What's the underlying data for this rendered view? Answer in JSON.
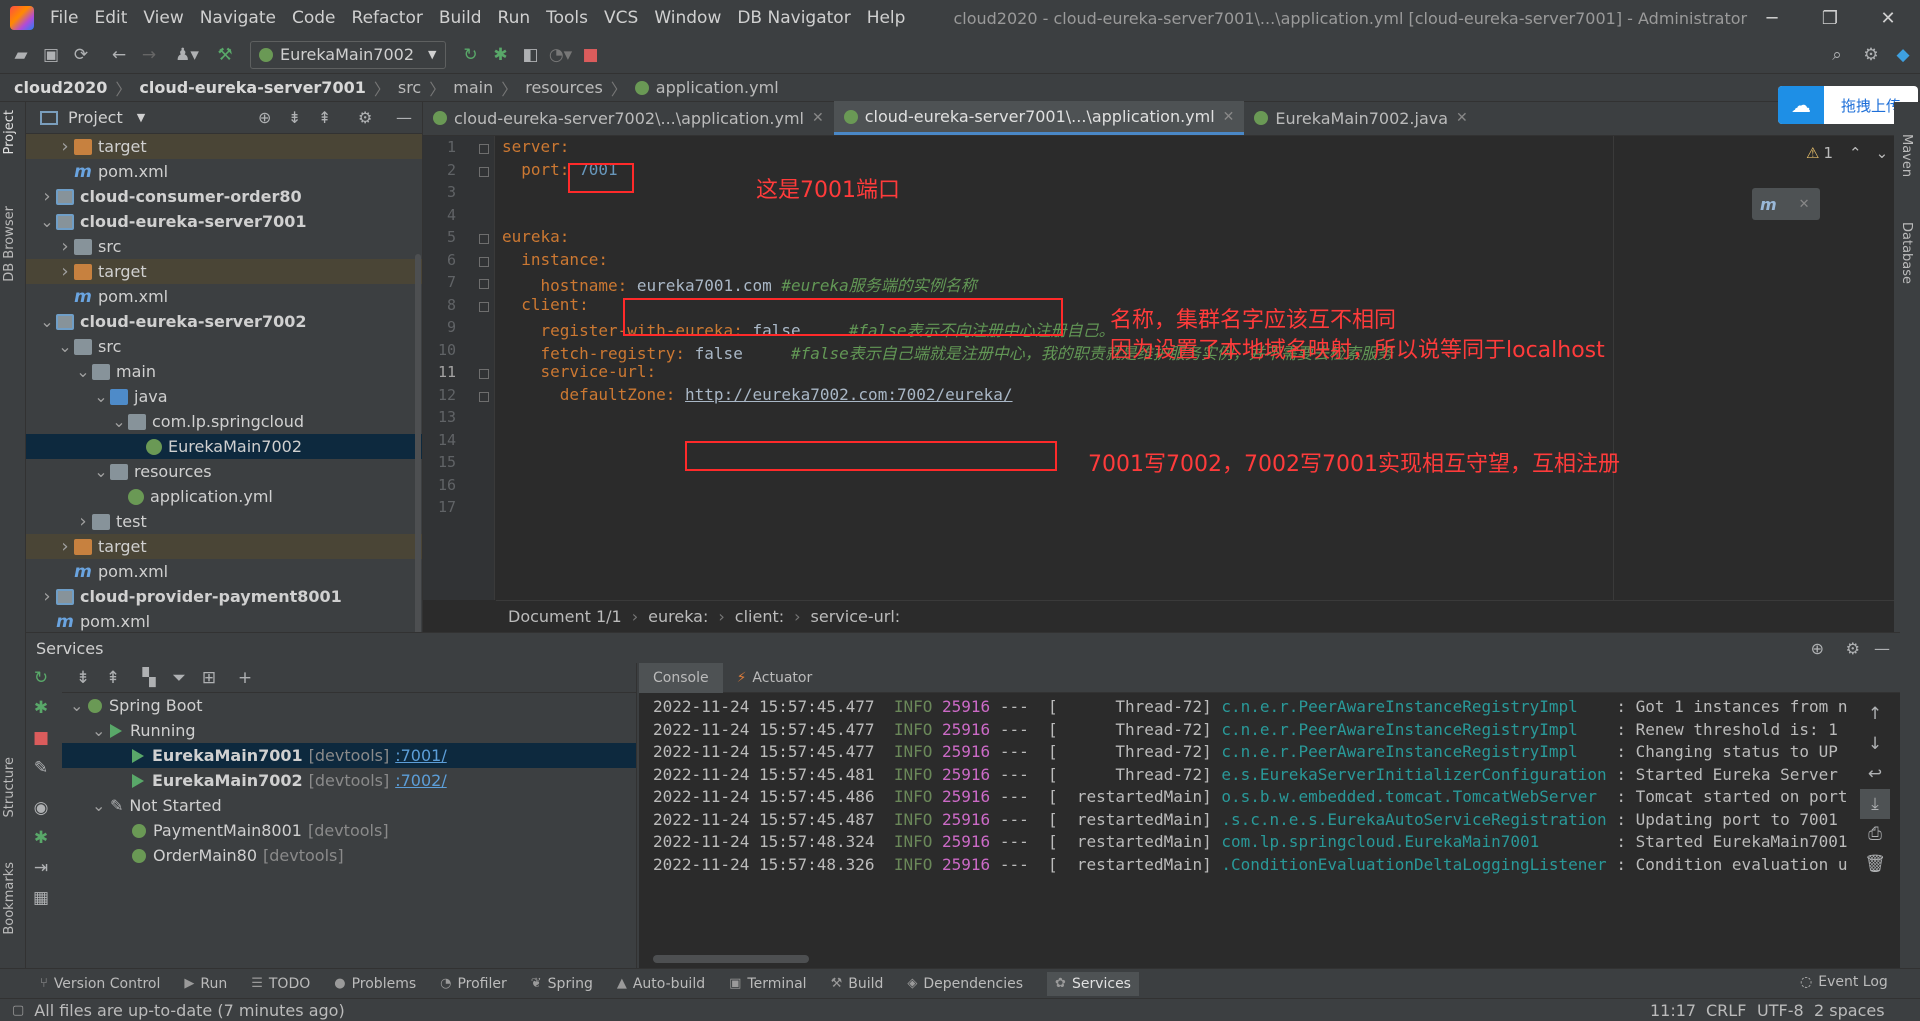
{
  "menubar": {
    "items": [
      "File",
      "Edit",
      "View",
      "Navigate",
      "Code",
      "Refactor",
      "Build",
      "Run",
      "Tools",
      "VCS",
      "Window",
      "DB Navigator",
      "Help"
    ],
    "title": "cloud2020 - cloud-eureka-server7001\\...\\application.yml [cloud-eureka-server7001] - Administrator"
  },
  "toolbar": {
    "run_config": "EurekaMain7002"
  },
  "breadcrumb": {
    "items": [
      "cloud2020",
      "cloud-eureka-server7001",
      "src",
      "main",
      "resources",
      "application.yml"
    ]
  },
  "project": {
    "title": "Project",
    "nodes": [
      {
        "label": "target",
        "type": "folder-orange",
        "depth": 2,
        "arrow": ">",
        "style": "tgt"
      },
      {
        "label": "pom.xml",
        "type": "maven",
        "depth": 2,
        "arrow": "",
        "style": ""
      },
      {
        "label": "cloud-consumer-order80",
        "type": "module",
        "depth": 1,
        "arrow": ">",
        "style": "",
        "bold": true
      },
      {
        "label": "cloud-eureka-server7001",
        "type": "module",
        "depth": 1,
        "arrow": "v",
        "style": "",
        "bold": true
      },
      {
        "label": "src",
        "type": "folder",
        "depth": 2,
        "arrow": ">",
        "style": ""
      },
      {
        "label": "target",
        "type": "folder-orange",
        "depth": 2,
        "arrow": ">",
        "style": "tgt"
      },
      {
        "label": "pom.xml",
        "type": "maven",
        "depth": 2,
        "arrow": "",
        "style": ""
      },
      {
        "label": "cloud-eureka-server7002",
        "type": "module",
        "depth": 1,
        "arrow": "v",
        "style": "",
        "bold": true
      },
      {
        "label": "src",
        "type": "folder",
        "depth": 2,
        "arrow": "v",
        "style": ""
      },
      {
        "label": "main",
        "type": "folder",
        "depth": 3,
        "arrow": "v",
        "style": ""
      },
      {
        "label": "java",
        "type": "folder-blue",
        "depth": 4,
        "arrow": "v",
        "style": ""
      },
      {
        "label": "com.lp.springcloud",
        "type": "package",
        "depth": 5,
        "arrow": "v",
        "style": ""
      },
      {
        "label": "EurekaMain7002",
        "type": "spring",
        "depth": 6,
        "arrow": "",
        "style": "sel"
      },
      {
        "label": "resources",
        "type": "folder",
        "depth": 4,
        "arrow": "v",
        "style": ""
      },
      {
        "label": "application.yml",
        "type": "spring",
        "depth": 5,
        "arrow": "",
        "style": ""
      },
      {
        "label": "test",
        "type": "folder",
        "depth": 3,
        "arrow": ">",
        "style": ""
      },
      {
        "label": "target",
        "type": "folder-orange",
        "depth": 2,
        "arrow": ">",
        "style": "tgt"
      },
      {
        "label": "pom.xml",
        "type": "maven",
        "depth": 2,
        "arrow": "",
        "style": ""
      },
      {
        "label": "cloud-provider-payment8001",
        "type": "module",
        "depth": 1,
        "arrow": ">",
        "style": "",
        "bold": true
      },
      {
        "label": "pom.xml",
        "type": "maven",
        "depth": 1,
        "arrow": "",
        "style": ""
      }
    ]
  },
  "tabs": [
    {
      "label": "cloud-eureka-server7002\\...\\application.yml",
      "active": false
    },
    {
      "label": "cloud-eureka-server7001\\...\\application.yml",
      "active": true
    },
    {
      "label": "EurekaMain7002.java",
      "active": false
    }
  ],
  "editor": {
    "line_numbers": [
      "1",
      "2",
      "3",
      "4",
      "5",
      "6",
      "7",
      "8",
      "9",
      "10",
      "11",
      "12",
      "13",
      "14",
      "15",
      "16",
      "17"
    ],
    "lines": [
      {
        "key": "server:",
        "val": "",
        "comment": ""
      },
      {
        "key": "  port: ",
        "val": "7001",
        "comment": "",
        "num": true
      },
      {
        "key": "",
        "val": "",
        "comment": ""
      },
      {
        "key": "",
        "val": "",
        "comment": ""
      },
      {
        "key": "eureka:",
        "val": "",
        "comment": ""
      },
      {
        "key": "  instance:",
        "val": "",
        "comment": ""
      },
      {
        "key": "    hostname: ",
        "val": "eureka7001.com ",
        "comment": "#eureka服务端的实例名称"
      },
      {
        "key": "  client:",
        "val": "",
        "comment": ""
      },
      {
        "key": "    register-with-eureka: ",
        "val": "false     ",
        "comment": "#false表示不向注册中心注册自己。"
      },
      {
        "key": "    fetch-registry: ",
        "val": "false     ",
        "comment": "#false表示自己端就是注册中心，我的职责就是维护服务实例，并不需要去检索服务"
      },
      {
        "key": "    service-url:",
        "val": "",
        "comment": ""
      },
      {
        "key": "      defaultZone: ",
        "val": "http://eureka7002.com:7002/eureka/",
        "comment": "",
        "url": true
      },
      {
        "key": "",
        "val": "",
        "comment": ""
      },
      {
        "key": "",
        "val": "",
        "comment": ""
      },
      {
        "key": "",
        "val": "",
        "comment": ""
      },
      {
        "key": "",
        "val": "",
        "comment": ""
      },
      {
        "key": "",
        "val": "",
        "comment": ""
      }
    ],
    "warnings": "1",
    "breadcrumb": [
      "Document 1/1",
      "eureka:",
      "client:",
      "service-url:"
    ]
  },
  "annotations": {
    "port_note": "这是7001端口",
    "name_note_1": "名称，集群名字应该互不相同",
    "name_note_2": "因为设置了本地域名映射，所以说等同于localhost",
    "url_note": "7001写7002，7002写7001实现相互守望，互相注册"
  },
  "upload_widget": {
    "label": "拖拽上传"
  },
  "services": {
    "title": "Services",
    "tree": [
      {
        "label": "Spring Boot",
        "depth": 0,
        "arrow": "v",
        "icon": "spring",
        "style": ""
      },
      {
        "label": "Running",
        "depth": 1,
        "arrow": "v",
        "icon": "run",
        "style": ""
      },
      {
        "label": "EurekaMain7001",
        "depth": 2,
        "arrow": "",
        "icon": "run",
        "style": "sel",
        "dim": "[devtools]",
        "link": ":7001/"
      },
      {
        "label": "EurekaMain7002",
        "depth": 2,
        "arrow": "",
        "icon": "run",
        "style": "",
        "dim": "[devtools]",
        "link": ":7002/"
      },
      {
        "label": "Not Started",
        "depth": 1,
        "arrow": "v",
        "icon": "wrench",
        "style": ""
      },
      {
        "label": "PaymentMain8001",
        "depth": 2,
        "arrow": "",
        "icon": "spring",
        "style": "",
        "dim": "[devtools]"
      },
      {
        "label": "OrderMain80",
        "depth": 2,
        "arrow": "",
        "icon": "spring",
        "style": "",
        "dim": "[devtools]"
      }
    ],
    "console_tabs": [
      "Console",
      "Actuator"
    ],
    "log": [
      {
        "ts": "2022-11-24 15:57:45.477",
        "lvl": "INFO",
        "pid": "25916",
        "thread": "---  [      Thread-72]",
        "cls": "c.n.e.r.PeerAwareInstanceRegistryImpl   ",
        "msg": ": Got 1 instances from n"
      },
      {
        "ts": "2022-11-24 15:57:45.477",
        "lvl": "INFO",
        "pid": "25916",
        "thread": "---  [      Thread-72]",
        "cls": "c.n.e.r.PeerAwareInstanceRegistryImpl   ",
        "msg": ": Renew threshold is: 1"
      },
      {
        "ts": "2022-11-24 15:57:45.477",
        "lvl": "INFO",
        "pid": "25916",
        "thread": "---  [      Thread-72]",
        "cls": "c.n.e.r.PeerAwareInstanceRegistryImpl   ",
        "msg": ": Changing status to UP"
      },
      {
        "ts": "2022-11-24 15:57:45.481",
        "lvl": "INFO",
        "pid": "25916",
        "thread": "---  [      Thread-72]",
        "cls": "e.s.EurekaServerInitializerConfiguration",
        "msg": ": Started Eureka Server"
      },
      {
        "ts": "2022-11-24 15:57:45.486",
        "lvl": "INFO",
        "pid": "25916",
        "thread": "---  [  restartedMain]",
        "cls": "o.s.b.w.embedded.tomcat.TomcatWebServer ",
        "msg": ": Tomcat started on port"
      },
      {
        "ts": "2022-11-24 15:57:45.487",
        "lvl": "INFO",
        "pid": "25916",
        "thread": "---  [  restartedMain]",
        "cls": ".s.c.n.e.s.EurekaAutoServiceRegistration",
        "msg": ": Updating port to 7001"
      },
      {
        "ts": "2022-11-24 15:57:48.324",
        "lvl": "INFO",
        "pid": "25916",
        "thread": "---  [  restartedMain]",
        "cls": "com.lp.springcloud.EurekaMain7001       ",
        "msg": ": Started EurekaMain7001"
      },
      {
        "ts": "2022-11-24 15:57:48.326",
        "lvl": "INFO",
        "pid": "25916",
        "thread": "---  [  restartedMain]",
        "cls": ".ConditionEvaluationDeltaLoggingListener",
        "msg": ": Condition evaluation u"
      }
    ]
  },
  "bottom_tabs": [
    {
      "label": "Version Control",
      "icon": "⑂"
    },
    {
      "label": "Run",
      "icon": "▶"
    },
    {
      "label": "TODO",
      "icon": "☰"
    },
    {
      "label": "Problems",
      "icon": "●"
    },
    {
      "label": "Profiler",
      "icon": "◔"
    },
    {
      "label": "Spring",
      "icon": "❦"
    },
    {
      "label": "Auto-build",
      "icon": "▲"
    },
    {
      "label": "Terminal",
      "icon": "▣"
    },
    {
      "label": "Build",
      "icon": "⚒"
    },
    {
      "label": "Dependencies",
      "icon": "◈"
    },
    {
      "label": "Services",
      "icon": "✿",
      "active": true
    }
  ],
  "event_log": "Event Log",
  "status": {
    "message": "All files are up-to-date (7 minutes ago)",
    "pos": "11:17",
    "eol": "CRLF",
    "enc": "UTF-8",
    "indent": "2 spaces"
  },
  "side_tabs": {
    "left": [
      "Project",
      "DB Browser",
      "Structure",
      "Bookmarks"
    ],
    "right": [
      "Maven",
      "Database"
    ]
  },
  "colors": {
    "accent": "#4a88c7",
    "annotation": "#ff2a2a",
    "keyword": "#cc7832",
    "number": "#6897bb",
    "comment": "#629755"
  }
}
